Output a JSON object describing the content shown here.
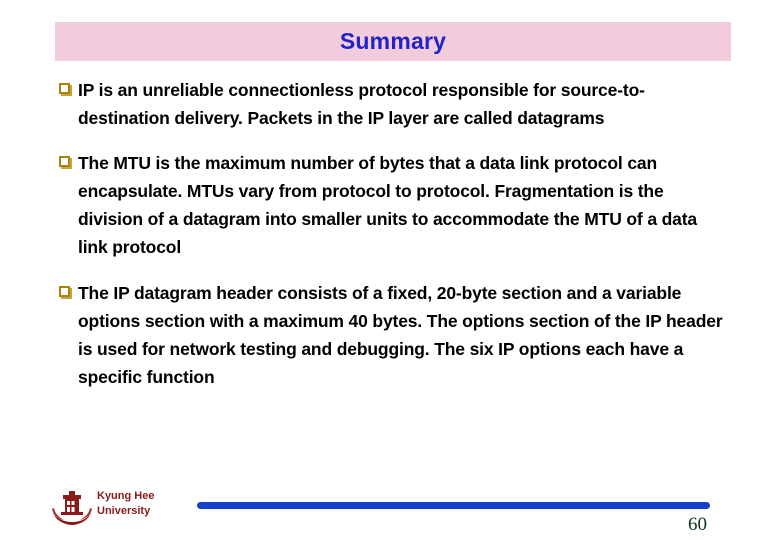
{
  "slide": {
    "title": "Summary",
    "colors": {
      "title_band": "#F2CBDD",
      "title_text": "#2222C8",
      "bullet_marker": "#A8840F",
      "body_text": "#000000",
      "footer_brand": "#8B1A1A",
      "footer_bar": "#1540CC",
      "page_number": "#11331E",
      "background": "#FFFFFF"
    },
    "bullets": [
      {
        "marker": "hollow-square-bullet",
        "text": "IP is an unreliable connectionless protocol responsible for source-to-destination delivery. Packets in the IP layer are called datagrams"
      },
      {
        "marker": "hollow-square-bullet",
        "text": "The MTU is the maximum number of bytes that a data link protocol can encapsulate. MTUs vary from protocol to protocol. Fragmentation is the division of a datagram into smaller units to accommodate the MTU of a data link protocol"
      },
      {
        "marker": "hollow-square-bullet",
        "text": "The IP datagram header consists of a fixed, 20-byte section and a variable options section with a maximum 40 bytes. The options section of the IP header is used for network testing and debugging. The six IP options each have a specific function"
      }
    ],
    "footer": {
      "logo_icon": "kyung-hee-university-crest-icon",
      "brand_line1": "Kyung Hee",
      "brand_line2": "University",
      "page_number": "60"
    }
  }
}
